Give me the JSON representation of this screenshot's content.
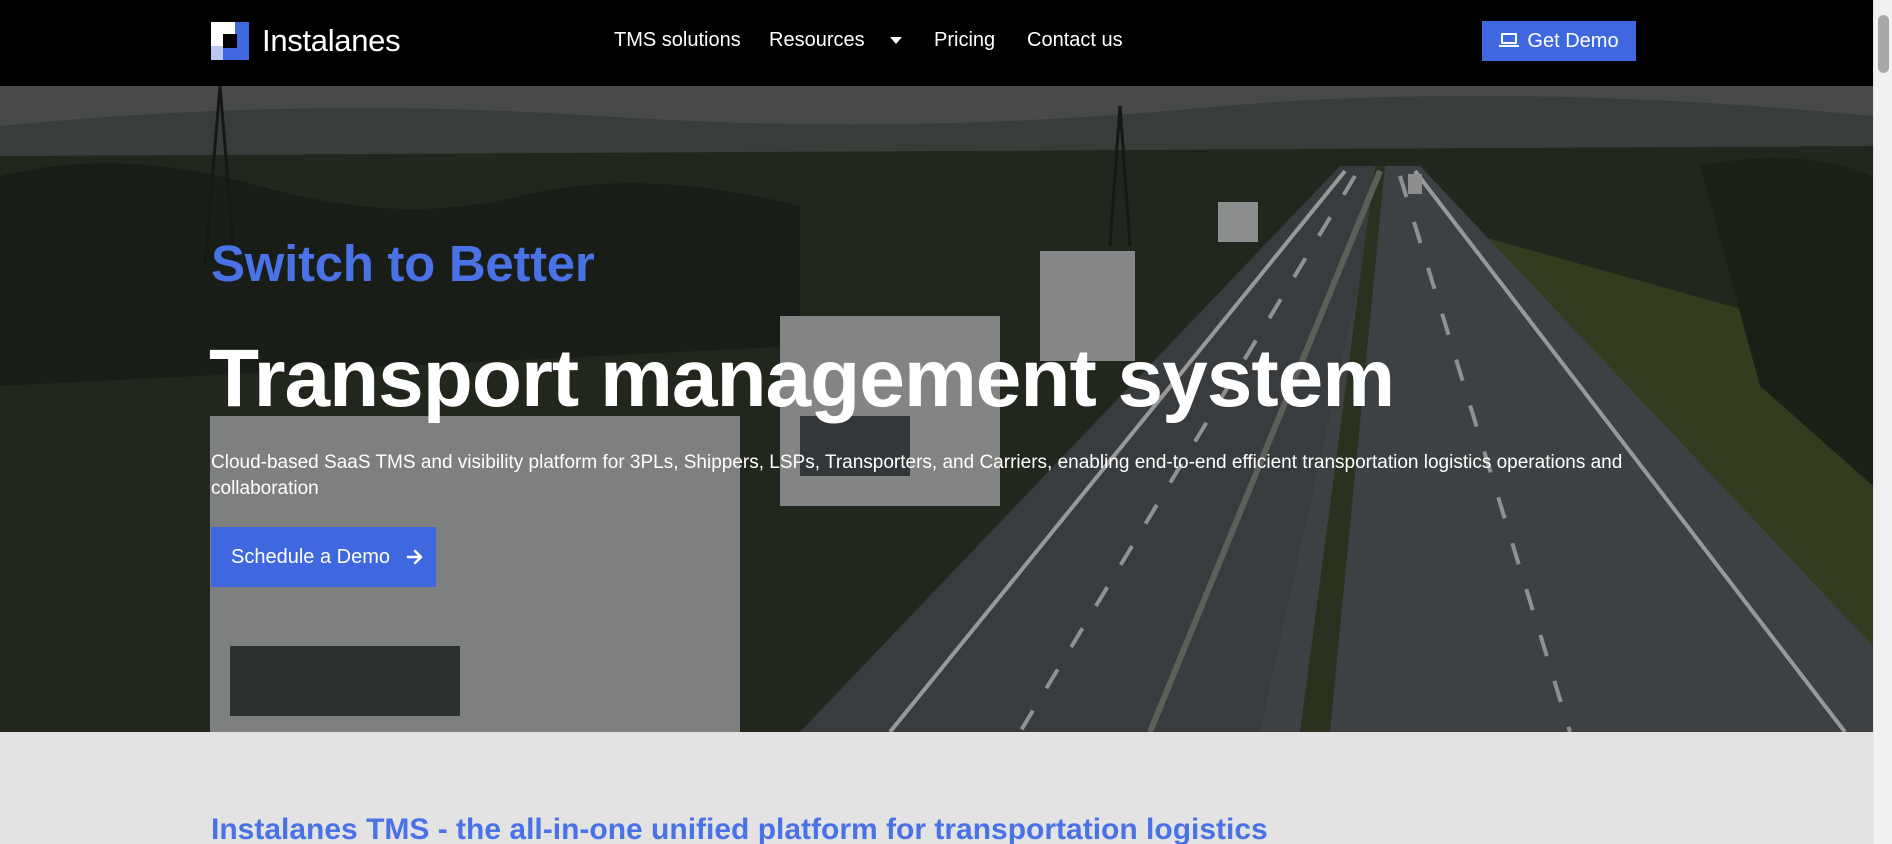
{
  "brand": {
    "name": "Instalanes"
  },
  "nav": {
    "items": [
      {
        "label": "TMS solutions"
      },
      {
        "label": "Resources"
      },
      {
        "label": "Pricing"
      },
      {
        "label": "Contact us"
      }
    ],
    "cta_label": "Get Demo"
  },
  "hero": {
    "kicker": "Switch to Better",
    "title": "Transport management system",
    "description": "Cloud-based SaaS TMS and visibility platform for 3PLs, Shippers, LSPs, Transporters, and Carriers, enabling end-to-end efficient transportation logistics operations and collaboration",
    "cta_label": "Schedule a Demo",
    "background": "highway with trucks"
  },
  "section": {
    "heading": "Instalanes TMS - the all-in-one unified platform for transportation logistics"
  },
  "colors": {
    "accent": "#3f67e0",
    "header_bg": "#000000",
    "section_bg": "#e3e3e3"
  },
  "icons": {
    "dropdown": "chevron-down-icon",
    "demo": "laptop-icon",
    "cta": "arrow-right-icon"
  }
}
